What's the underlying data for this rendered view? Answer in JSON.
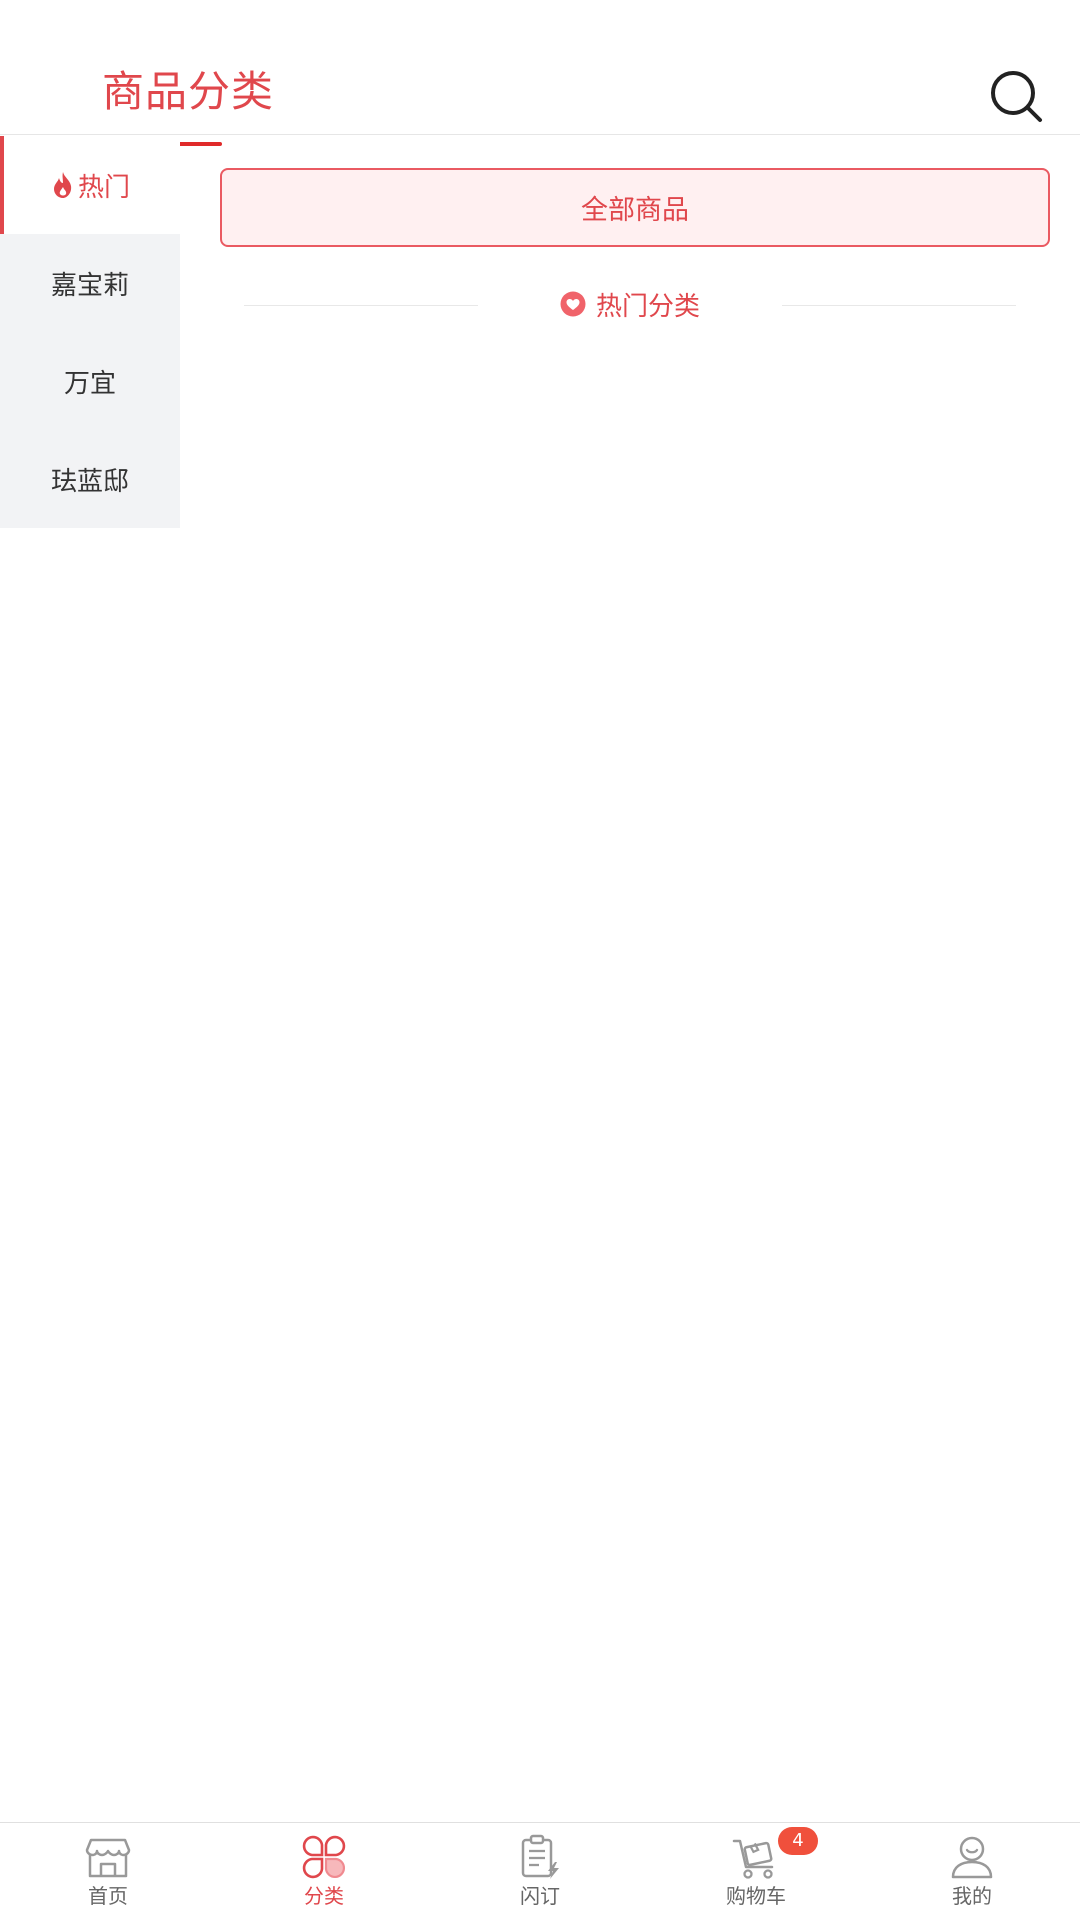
{
  "header": {
    "title": "商品分类",
    "search_icon": "search-icon"
  },
  "sidebar": {
    "items": [
      {
        "label": "热门",
        "icon": "flame-icon",
        "active": true
      },
      {
        "label": "嘉宝莉",
        "active": false
      },
      {
        "label": "万宜",
        "active": false
      },
      {
        "label": "珐蓝邸",
        "active": false
      }
    ]
  },
  "main": {
    "all_goods_label": "全部商品",
    "section_title": "热门分类",
    "section_icon": "heart-icon"
  },
  "tab_bar": {
    "tabs": [
      {
        "label": "首页",
        "icon": "shop-icon",
        "active": false
      },
      {
        "label": "分类",
        "icon": "category-icon",
        "active": true
      },
      {
        "label": "闪订",
        "icon": "flash-order-icon",
        "active": false
      },
      {
        "label": "购物车",
        "icon": "cart-icon",
        "active": false,
        "badge": "4"
      },
      {
        "label": "我的",
        "icon": "user-icon",
        "active": false
      }
    ]
  },
  "colors": {
    "accent": "#e0474c",
    "accent_light": "#fff0f1",
    "sidebar_bg": "#f2f3f5",
    "badge": "#f0503c"
  }
}
